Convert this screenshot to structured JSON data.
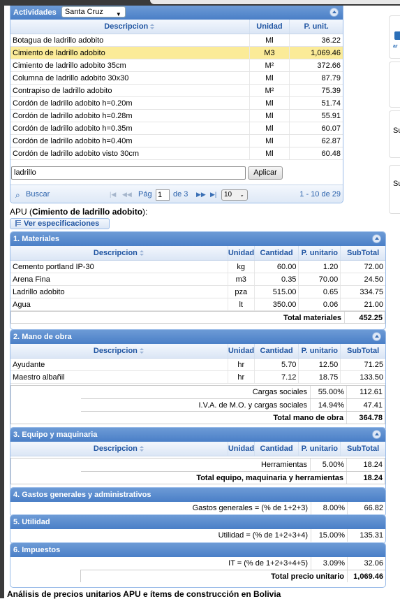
{
  "activities": {
    "label": "Actividades",
    "city": "Santa Cruz",
    "columns": {
      "desc": "Descripcion",
      "unit": "Unidad",
      "price": "P. unit."
    },
    "rows": [
      {
        "desc": "Botagua de ladrillo adobito",
        "unit": "Ml",
        "price": "36.22"
      },
      {
        "desc": "Cimiento de ladrillo adobito",
        "unit": "M3",
        "price": "1,069.46"
      },
      {
        "desc": "Cimiento de ladrillo adobito 35cm",
        "unit": "M²",
        "price": "372.66"
      },
      {
        "desc": "Columna de ladrillo adobito 30x30",
        "unit": "Ml",
        "price": "87.79"
      },
      {
        "desc": "Contrapiso de ladrillo adobito",
        "unit": "M²",
        "price": "75.39"
      },
      {
        "desc": "Cordón de ladrillo adobito h=0.20m",
        "unit": "Ml",
        "price": "51.74"
      },
      {
        "desc": "Cordón de ladrillo adobito h=0.28m",
        "unit": "Ml",
        "price": "55.91"
      },
      {
        "desc": "Cordón de ladrillo adobito h=0.35m",
        "unit": "Ml",
        "price": "60.07"
      },
      {
        "desc": "Cordón de ladrillo adobito h=0.40m",
        "unit": "Ml",
        "price": "62.87"
      },
      {
        "desc": "Cordón de ladrillo adobito visto 30cm",
        "unit": "Ml",
        "price": "60.48"
      }
    ],
    "filter_value": "ladrillo",
    "apply_label": "Aplicar",
    "pager": {
      "search": "Buscar",
      "page_label": "Pág",
      "page": "1",
      "of": "de 3",
      "size": "10",
      "range": "1 - 10 de 29"
    }
  },
  "apu": {
    "prefix": "APU (",
    "name": "Cimiento de ladrillo adobito",
    "suffix": "):",
    "spec_button": "Ver especificaciones"
  },
  "cols": {
    "desc": "Descripcion",
    "unit": "Unidad",
    "qty": "Cantidad",
    "pu": "P. unitario",
    "st": "SubTotal"
  },
  "materiales": {
    "title": "1. Materiales",
    "rows": [
      {
        "desc": "Cemento portland IP-30",
        "unit": "kg",
        "qty": "60.00",
        "pu": "1.20",
        "st": "72.00"
      },
      {
        "desc": "Arena Fina",
        "unit": "m3",
        "qty": "0.35",
        "pu": "70.00",
        "st": "24.50"
      },
      {
        "desc": "Ladrillo adobito",
        "unit": "pza",
        "qty": "515.00",
        "pu": "0.65",
        "st": "334.75"
      },
      {
        "desc": "Agua",
        "unit": "lt",
        "qty": "350.00",
        "pu": "0.06",
        "st": "21.00"
      }
    ],
    "total_label": "Total materiales",
    "total": "452.25"
  },
  "mano": {
    "title": "2. Mano de obra",
    "rows": [
      {
        "desc": "Ayudante",
        "unit": "hr",
        "qty": "5.70",
        "pu": "12.50",
        "st": "71.25"
      },
      {
        "desc": "Maestro albañil",
        "unit": "hr",
        "qty": "7.12",
        "pu": "18.75",
        "st": "133.50"
      }
    ],
    "cargas_label": "Cargas sociales",
    "cargas_pct": "55.00%",
    "cargas": "112.61",
    "iva_label": "I.V.A. de M.O. y cargas sociales",
    "iva_pct": "14.94%",
    "iva": "47.41",
    "total_label": "Total mano de obra",
    "total": "364.78"
  },
  "equipo": {
    "title": "3. Equipo y maquinaria",
    "herr_label": "Herramientas",
    "herr_pct": "5.00%",
    "herr": "18.24",
    "total_label": "Total equipo, maquinaria y herramientas",
    "total": "18.24"
  },
  "gastos": {
    "title": "4. Gastos generales y administrativos",
    "label": "Gastos generales = (% de 1+2+3)",
    "pct": "8.00%",
    "val": "66.82"
  },
  "utilidad": {
    "title": "5. Utilidad",
    "label": "Utilidad = (% de 1+2+3+4)",
    "pct": "15.00%",
    "val": "135.31"
  },
  "impuestos": {
    "title": "6. Impuestos",
    "label": "IT = (% de 1+2+3+4+5)",
    "pct": "3.09%",
    "val": "32.06",
    "total_label": "Total precio unitario",
    "total": "1,069.46"
  },
  "side": {
    "s1": "ar",
    "s2": "Su",
    "s3": "Su"
  },
  "footer": "Análisis de precios unitarios APU e ítems de construcción en Bolivia",
  "colors": {
    "header": "#4a7fc7",
    "selected_row": "#fbeb98",
    "header_text": "#1f54a1"
  }
}
